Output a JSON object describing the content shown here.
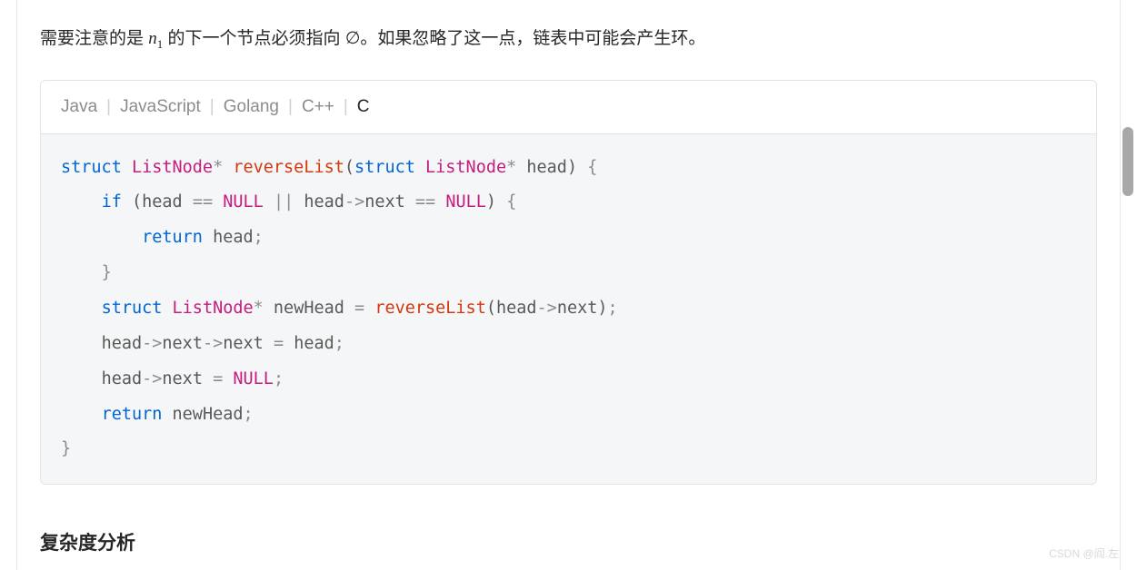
{
  "intro": {
    "prefix": "需要注意的是 ",
    "var_name": "n",
    "var_sub": "1",
    "mid": " 的下一个节点必须指向 ",
    "empty_set": "∅",
    "suffix": "。如果忽略了这一点，链表中可能会产生环。"
  },
  "tabs": {
    "items": [
      "Java",
      "JavaScript",
      "Golang",
      "C++",
      "C"
    ],
    "active_index": 4,
    "separator": "|"
  },
  "code": {
    "lines": [
      {
        "indent": 0,
        "tokens": [
          {
            "t": "kw",
            "v": "struct"
          },
          {
            "t": "sp",
            "v": " "
          },
          {
            "t": "type",
            "v": "ListNode"
          },
          {
            "t": "op",
            "v": "*"
          },
          {
            "t": "sp",
            "v": " "
          },
          {
            "t": "fn",
            "v": "reverseList"
          },
          {
            "t": "paren",
            "v": "("
          },
          {
            "t": "kw",
            "v": "struct"
          },
          {
            "t": "sp",
            "v": " "
          },
          {
            "t": "type",
            "v": "ListNode"
          },
          {
            "t": "op",
            "v": "*"
          },
          {
            "t": "sp",
            "v": " "
          },
          {
            "t": "txt",
            "v": "head"
          },
          {
            "t": "paren",
            "v": ")"
          },
          {
            "t": "sp",
            "v": " "
          },
          {
            "t": "punc",
            "v": "{"
          }
        ]
      },
      {
        "indent": 1,
        "tokens": [
          {
            "t": "kw",
            "v": "if"
          },
          {
            "t": "sp",
            "v": " "
          },
          {
            "t": "paren",
            "v": "("
          },
          {
            "t": "txt",
            "v": "head "
          },
          {
            "t": "op",
            "v": "=="
          },
          {
            "t": "sp",
            "v": " "
          },
          {
            "t": "const",
            "v": "NULL"
          },
          {
            "t": "sp",
            "v": " "
          },
          {
            "t": "op",
            "v": "||"
          },
          {
            "t": "sp",
            "v": " "
          },
          {
            "t": "txt",
            "v": "head"
          },
          {
            "t": "op",
            "v": "->"
          },
          {
            "t": "txt",
            "v": "next "
          },
          {
            "t": "op",
            "v": "=="
          },
          {
            "t": "sp",
            "v": " "
          },
          {
            "t": "const",
            "v": "NULL"
          },
          {
            "t": "paren",
            "v": ")"
          },
          {
            "t": "sp",
            "v": " "
          },
          {
            "t": "punc",
            "v": "{"
          }
        ]
      },
      {
        "indent": 2,
        "tokens": [
          {
            "t": "kw",
            "v": "return"
          },
          {
            "t": "sp",
            "v": " "
          },
          {
            "t": "txt",
            "v": "head"
          },
          {
            "t": "punc",
            "v": ";"
          }
        ]
      },
      {
        "indent": 1,
        "tokens": [
          {
            "t": "punc",
            "v": "}"
          }
        ]
      },
      {
        "indent": 1,
        "tokens": [
          {
            "t": "kw",
            "v": "struct"
          },
          {
            "t": "sp",
            "v": " "
          },
          {
            "t": "type",
            "v": "ListNode"
          },
          {
            "t": "op",
            "v": "*"
          },
          {
            "t": "sp",
            "v": " "
          },
          {
            "t": "txt",
            "v": "newHead "
          },
          {
            "t": "op",
            "v": "="
          },
          {
            "t": "sp",
            "v": " "
          },
          {
            "t": "fn",
            "v": "reverseList"
          },
          {
            "t": "paren",
            "v": "("
          },
          {
            "t": "txt",
            "v": "head"
          },
          {
            "t": "op",
            "v": "->"
          },
          {
            "t": "txt",
            "v": "next"
          },
          {
            "t": "paren",
            "v": ")"
          },
          {
            "t": "punc",
            "v": ";"
          }
        ]
      },
      {
        "indent": 1,
        "tokens": [
          {
            "t": "txt",
            "v": "head"
          },
          {
            "t": "op",
            "v": "->"
          },
          {
            "t": "txt",
            "v": "next"
          },
          {
            "t": "op",
            "v": "->"
          },
          {
            "t": "txt",
            "v": "next "
          },
          {
            "t": "op",
            "v": "="
          },
          {
            "t": "sp",
            "v": " "
          },
          {
            "t": "txt",
            "v": "head"
          },
          {
            "t": "punc",
            "v": ";"
          }
        ]
      },
      {
        "indent": 1,
        "tokens": [
          {
            "t": "txt",
            "v": "head"
          },
          {
            "t": "op",
            "v": "->"
          },
          {
            "t": "txt",
            "v": "next "
          },
          {
            "t": "op",
            "v": "="
          },
          {
            "t": "sp",
            "v": " "
          },
          {
            "t": "const",
            "v": "NULL"
          },
          {
            "t": "punc",
            "v": ";"
          }
        ]
      },
      {
        "indent": 1,
        "tokens": [
          {
            "t": "kw",
            "v": "return"
          },
          {
            "t": "sp",
            "v": " "
          },
          {
            "t": "txt",
            "v": "newHead"
          },
          {
            "t": "punc",
            "v": ";"
          }
        ]
      },
      {
        "indent": 0,
        "tokens": [
          {
            "t": "punc",
            "v": "}"
          }
        ]
      }
    ]
  },
  "section_heading": "复杂度分析",
  "watermark": "CSDN @阎.左"
}
